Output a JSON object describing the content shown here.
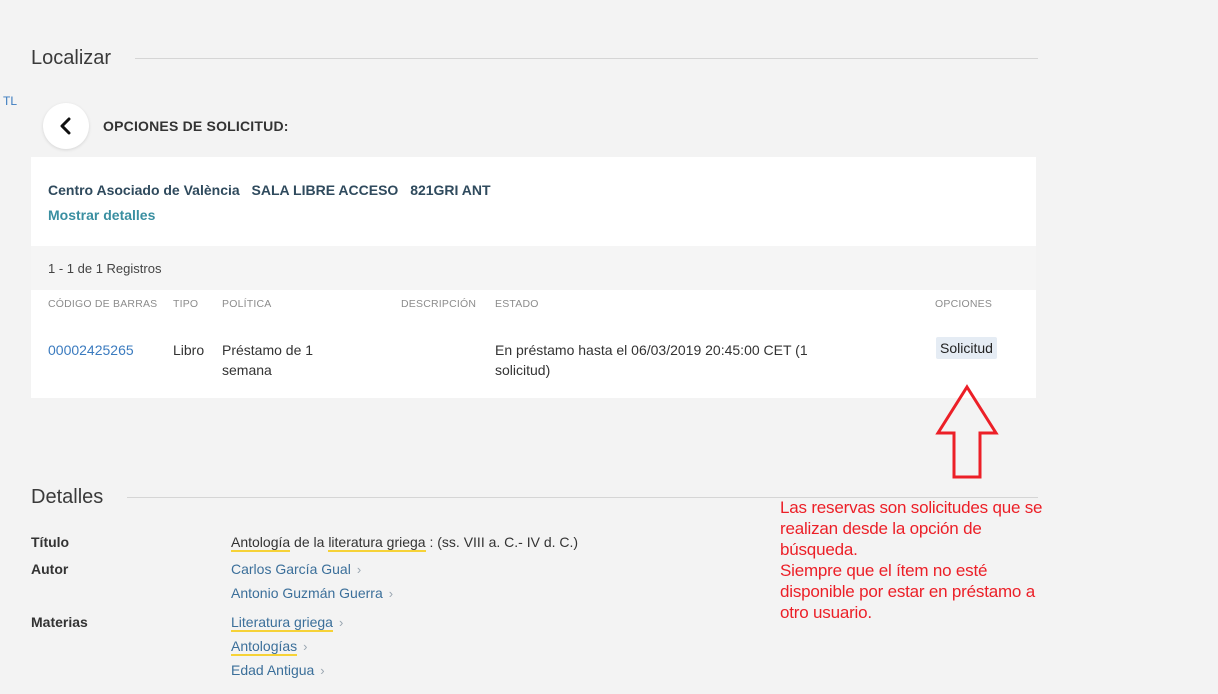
{
  "locate": {
    "title": "Localizar",
    "edge_text": "TL",
    "options_title": "OPCIONES DE SOLICITUD:",
    "location": {
      "library": "Centro Asociado de València",
      "collection": "SALA LIBRE ACCESO",
      "call_number": "821GRI ANT"
    },
    "show_details": "Mostrar detalles",
    "records": "1 - 1 de 1 Registros",
    "columns": {
      "barcode": "CÓDIGO DE BARRAS",
      "type": "TIPO",
      "policy": "POLÍTICA",
      "description": "DESCRIPCIÓN",
      "status": "ESTADO",
      "options": "OPCIONES"
    },
    "row": {
      "barcode": "00002425265",
      "type": "Libro",
      "policy_line1": "Préstamo de 1",
      "policy_line2": "semana",
      "description": "",
      "status_line1": "En préstamo hasta el 06/03/2019 20:45:00 CET (1",
      "status_line2": "solicitud)",
      "request_label": "Solicitud"
    }
  },
  "details": {
    "title": "Detalles",
    "labels": {
      "title": "Título",
      "author": "Autor",
      "subjects": "Materias"
    },
    "title_parts": {
      "p1": "Antología",
      "p2": " de la ",
      "p3": "literatura griega",
      "p4": " : (ss. VIII a. C.- IV d. C.)"
    },
    "authors": [
      "Carlos García Gual",
      "Antonio Guzmán Guerra"
    ],
    "subjects": [
      "Literatura griega",
      "Antologías",
      "Edad Antigua"
    ],
    "chevron": "›"
  },
  "annotation": {
    "lines": [
      "Las reservas son solicitudes que se",
      "realizan desde la opción de",
      "búsqueda.",
      "Siempre que el ítem no esté",
      "disponible por estar en préstamo a",
      "otro usuario."
    ],
    "color": "#ec1f27"
  },
  "colors": {
    "background": "#f3f3f3",
    "link": "#3b7bbf",
    "highlight": "#f6d237"
  },
  "icons": {
    "back": "chevron-left-icon",
    "arrow": "red-up-arrow-icon",
    "chevron": "chevron-right-icon"
  }
}
